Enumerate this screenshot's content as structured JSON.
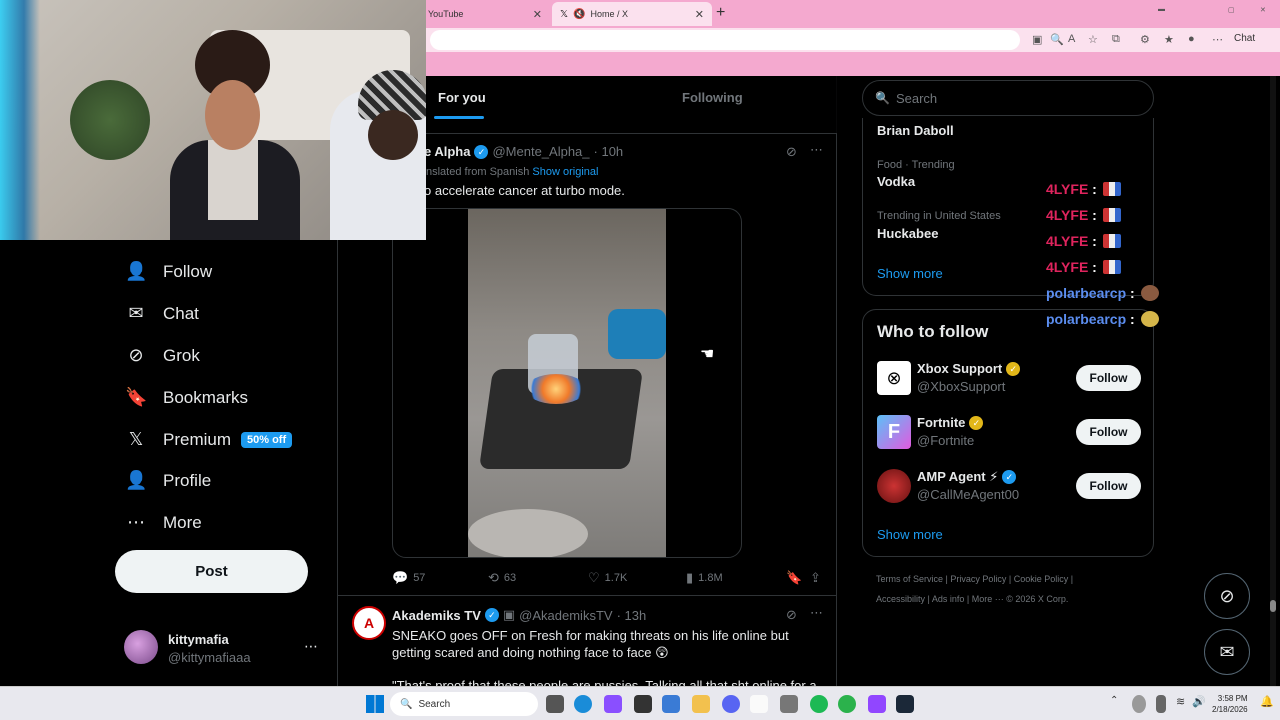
{
  "browser": {
    "tab_inactive": "YouTube",
    "tab_active": "Home / X",
    "new_tab": "+",
    "chat": "Chat"
  },
  "nav": [
    {
      "label": "Follow",
      "icon": "person-add-icon",
      "glyph": "👤"
    },
    {
      "label": "Chat",
      "icon": "mail-icon",
      "glyph": "✉"
    },
    {
      "label": "Grok",
      "icon": "grok-icon",
      "glyph": "⊘"
    },
    {
      "label": "Bookmarks",
      "icon": "bookmark-icon",
      "glyph": "🔖"
    },
    {
      "label": "Premium",
      "icon": "x-logo-icon",
      "glyph": "𝕏"
    },
    {
      "label": "Profile",
      "icon": "profile-icon",
      "glyph": "👤"
    },
    {
      "label": "More",
      "icon": "more-icon",
      "glyph": "⋯"
    }
  ],
  "premium_badge": "50% off",
  "post_button": "Post",
  "account": {
    "name": "kittymafia",
    "handle": "@kittymafiaaa"
  },
  "timeline": {
    "tab_for_you": "For you",
    "tab_following": "Following"
  },
  "tweet1": {
    "display_name": "e Alpha",
    "handle": "@Mente_Alpha_",
    "time": "· 10h",
    "translated": "nslated from Spanish",
    "show_original": "Show original",
    "text": "o accelerate cancer at turbo mode.",
    "replies": "57",
    "reposts": "63",
    "likes": "1.7K",
    "views": "1.8M"
  },
  "tweet2": {
    "display_name": "Akademiks TV",
    "handle": "@AkademiksTV",
    "time": "· 13h",
    "text": "SNEAKO goes OFF on Fresh for making threats on his life online but getting scared and doing nothing face to face 😲",
    "text2": "\"That's proof that these people are pussies. Talking all that sht online for a"
  },
  "search": {
    "placeholder": "Search"
  },
  "trends": [
    {
      "category": "",
      "name": "Brian Daboll"
    },
    {
      "category": "Food · Trending",
      "name": "Vodka"
    },
    {
      "category": "Trending in United States",
      "name": "Huckabee"
    }
  ],
  "trends_show_more": "Show more",
  "who_to_follow": {
    "title": "Who to follow",
    "accounts": [
      {
        "name": "Xbox Support",
        "handle": "@XboxSupport",
        "follow": "Follow"
      },
      {
        "name": "Fortnite",
        "handle": "@Fortnite",
        "follow": "Follow"
      },
      {
        "name": "AMP Agent ⚡",
        "handle": "@CallMeAgent00",
        "follow": "Follow"
      }
    ],
    "show_more": "Show more"
  },
  "footer": {
    "line1": "Terms of Service  |  Privacy Policy  |  Cookie Policy  |",
    "line2": "Accessibility  |  Ads info  |  More ···  © 2026 X Corp."
  },
  "chat_overlay": [
    {
      "user": "4LYFE",
      "color": "#e0245e"
    },
    {
      "user": "4LYFE",
      "color": "#e0245e"
    },
    {
      "user": "4LYFE",
      "color": "#e0245e"
    },
    {
      "user": "4LYFE",
      "color": "#e0245e"
    },
    {
      "user": "polarbearcp",
      "color": "#5b8def"
    },
    {
      "user": "polarbearcp",
      "color": "#5b8def"
    }
  ],
  "taskbar": {
    "search": "Search",
    "time": "3:58 PM",
    "date": "2/18/2026"
  }
}
